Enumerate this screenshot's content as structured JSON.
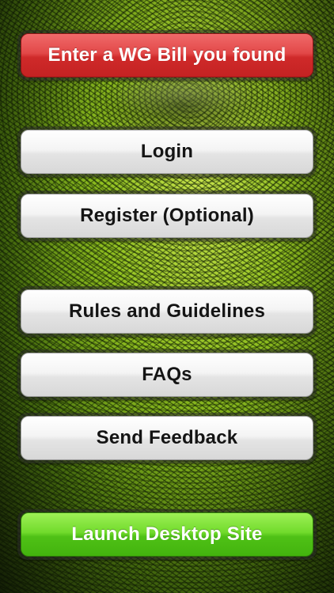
{
  "menu": {
    "enter_bill": {
      "label": "Enter a WG Bill you found",
      "color": "#d93535"
    },
    "login": {
      "label": "Login"
    },
    "register": {
      "label": "Register (Optional)"
    },
    "rules": {
      "label": "Rules and Guidelines"
    },
    "faqs": {
      "label": "FAQs"
    },
    "feedback": {
      "label": "Send Feedback"
    },
    "launch_desktop": {
      "label": "Launch Desktop Site",
      "color": "#5ac81e"
    }
  },
  "background": {
    "description_icon": "banknote-eye-background"
  }
}
